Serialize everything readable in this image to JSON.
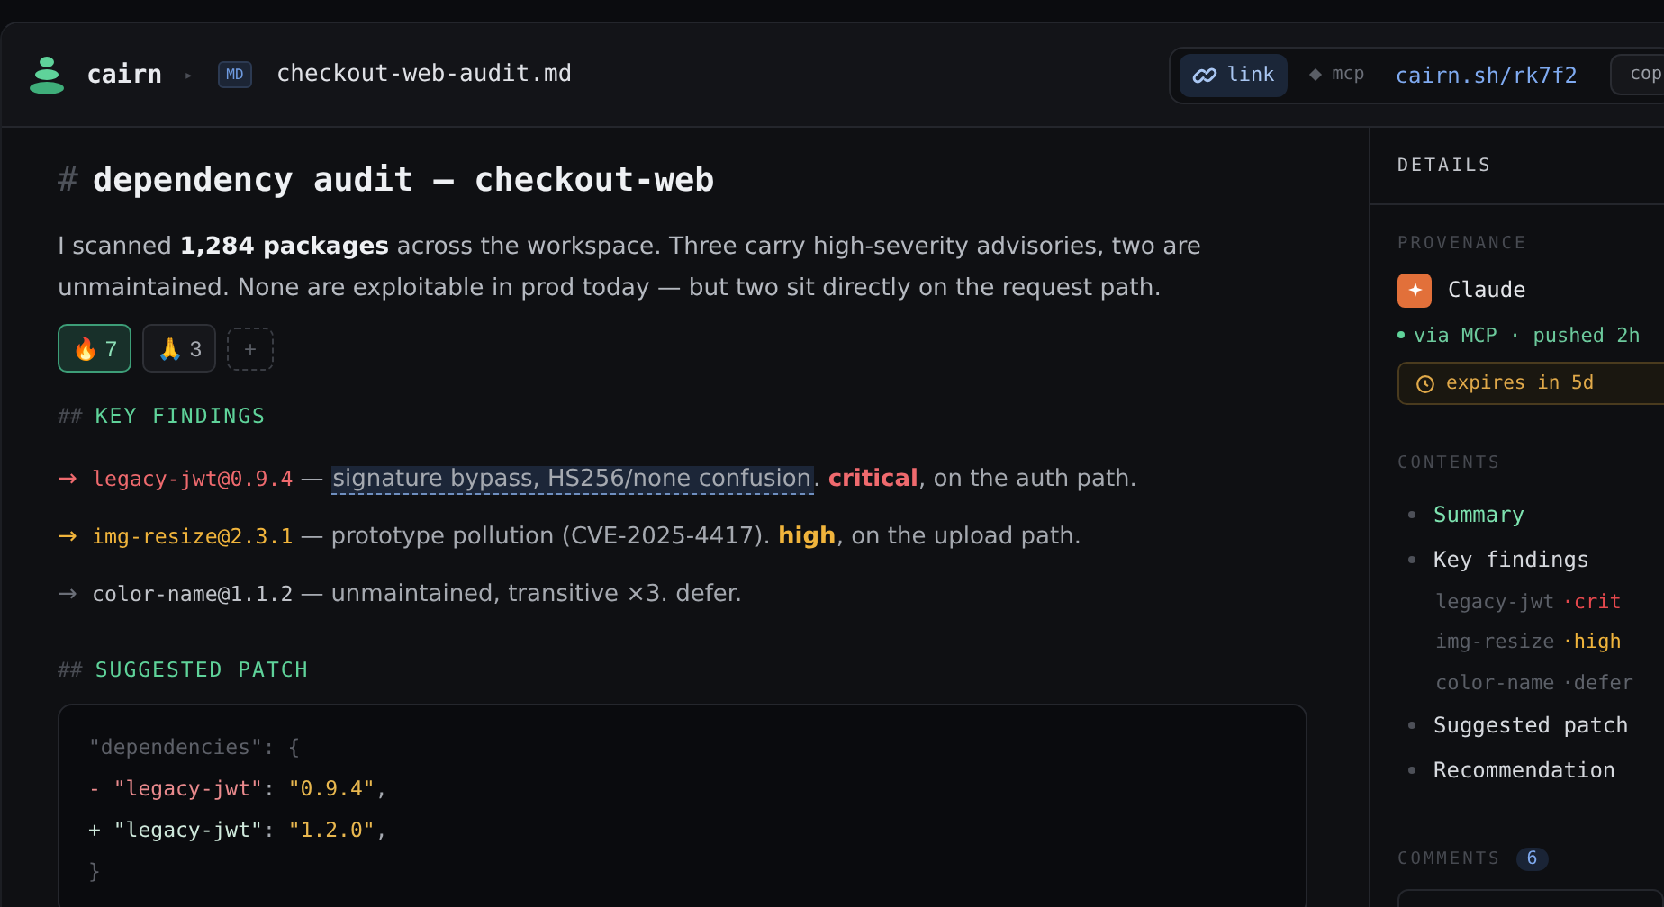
{
  "header": {
    "brand": "cairn",
    "separator": "▸",
    "file_badge": "MD",
    "file_name": "checkout-web-audit.md",
    "share_modes": [
      {
        "label": "link",
        "selected": true
      },
      {
        "label": "mcp",
        "selected": false
      }
    ],
    "url": "cairn.sh/rk7f2",
    "copy_label": "cop"
  },
  "document": {
    "title_mark": "#",
    "title": "dependency audit — checkout-web",
    "intro": "I scanned **1,284 packages** across the workspace. Three carry high-severity advisories, two are unmaintained. None are exploitable in prod today — but two sit directly on the request path.",
    "reactions": [
      {
        "emoji": "🔥",
        "count": "7",
        "selected": true
      },
      {
        "emoji": "🙏",
        "count": "3",
        "selected": false
      }
    ],
    "add_reaction": "+",
    "sections": [
      {
        "mark": "##",
        "heading": "KEY FINDINGS"
      },
      {
        "mark": "##",
        "heading": "SUGGESTED PATCH"
      }
    ],
    "findings": [
      {
        "kind": "critical",
        "arrow": "→",
        "package": "legacy-jwt@0.9.4",
        "dash": "—",
        "highlight": "signature bypass, HS256/none confusion",
        "text": ". **critical**, on the auth path."
      },
      {
        "kind": "high",
        "arrow": "→",
        "package": "img-resize@2.3.1",
        "dash": "—",
        "text": "prototype pollution (CVE-2025-4417). **high**, on the upload path."
      },
      {
        "kind": "defer",
        "arrow": "→",
        "package": "color-name@1.1.2",
        "dash": "—",
        "text": "unmaintained, transitive ×3. defer."
      }
    ],
    "patch": [
      {
        "kind": "context",
        "text": "\"dependencies\": {"
      },
      {
        "kind": "removed",
        "sign": "-",
        "key": "\"legacy-jwt\"",
        "colon": ":",
        "value": "\"0.9.4\"",
        "comma": ","
      },
      {
        "kind": "added",
        "sign": "+",
        "key": "\"legacy-jwt\"",
        "colon": ":",
        "value": "\"1.2.0\"",
        "comma": ","
      },
      {
        "kind": "context",
        "text": "}"
      }
    ]
  },
  "details": {
    "title": "DETAILS",
    "provenance": {
      "heading": "PROVENANCE",
      "author": "Claude",
      "source": "via MCP · pushed 2h",
      "expiry": "expires in 5d"
    },
    "contents": {
      "heading": "CONTENTS",
      "items": [
        {
          "label": "Summary",
          "selected": true
        },
        {
          "label": "Key findings",
          "selected": false,
          "children": [
            {
              "label": "legacy-jwt",
              "tag": "·crit",
              "color": "#e5484d"
            },
            {
              "label": "img-resize",
              "tag": "·high",
              "color": "#f0b43c"
            },
            {
              "label": "color-name",
              "tag": "·defer",
              "color": "#5f636b"
            }
          ]
        },
        {
          "label": "Suggested patch",
          "selected": false
        },
        {
          "label": "Recommendation",
          "selected": false
        }
      ]
    },
    "comments": {
      "heading": "COMMENTS",
      "count": "6"
    }
  }
}
